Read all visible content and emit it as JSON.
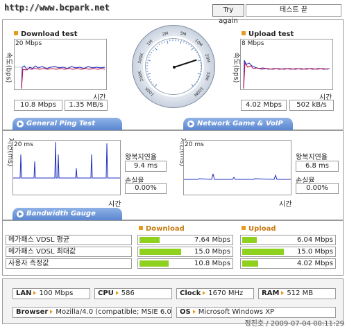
{
  "header": {
    "url_logo": "http://www.bcpark.net",
    "try_again": "Try again",
    "status": "테스트 끝"
  },
  "download": {
    "title": "Download test",
    "axis_y": "속도(bps)",
    "scale": "20 Mbps",
    "time_label": "시간",
    "mbps": "10.8 Mbps",
    "mbs": "1.35 MB/s"
  },
  "upload": {
    "title": "Upload test",
    "axis_y": "속도(bps)",
    "scale": "8 Mbps",
    "time_label": "시간",
    "mbps": "4.02 Mbps",
    "kbs": "502 kB/s"
  },
  "gauge": {
    "ticks": [
      "100K",
      "200K",
      "500K",
      "1M",
      "2M",
      "5M",
      "10M",
      "20M",
      "50M",
      "100M"
    ],
    "needle_tick_index": 6.9
  },
  "sections": {
    "ping": "General Ping Test",
    "game": "Network Game & VoIP Test",
    "bandwidth": "Bandwidth Gauge"
  },
  "ping": {
    "axis_y": "지연(ms)",
    "scale": "20 ms",
    "time_label": "시간",
    "latency_label": "왕복지연율",
    "latency": "9.4 ms",
    "loss_label": "손실율",
    "loss": "0.00%"
  },
  "game": {
    "axis_y": "지연(ms)",
    "scale": "20 ms",
    "time_label": "시간",
    "latency_label": "왕복지연율",
    "latency": "6.8 ms",
    "loss_label": "손실율",
    "loss": "0.00%"
  },
  "bandwidth": {
    "download_hdr": "Download",
    "upload_hdr": "Upload",
    "rows": [
      {
        "label": "메가패스 VDSL 평균",
        "down": "7.64 Mbps",
        "down_frac": 0.42,
        "up": "6.04 Mbps",
        "up_frac": 0.3
      },
      {
        "label": "메가패스 VDSL 최대값",
        "down": "15.0 Mbps",
        "down_frac": 0.85,
        "up": "15.0 Mbps",
        "up_frac": 0.85
      },
      {
        "label": "사용자 측정값",
        "down": "10.8 Mbps",
        "down_frac": 0.6,
        "up": "4.02 Mbps",
        "up_frac": 0.33
      }
    ]
  },
  "info": {
    "lan_label": "LAN",
    "lan": "100 Mbps",
    "cpu_label": "CPU",
    "cpu": "586",
    "clock_label": "Clock",
    "clock": "1670 MHz",
    "ram_label": "RAM",
    "ram": "512 MB",
    "browser_label": "Browser",
    "browser": "Mozilla/4.0 (compatible; MSIE 6.0",
    "os_label": "OS",
    "os": "Microsoft Windows XP"
  },
  "footer": "정진호 / 2009-07-04 00:11:29",
  "colors": {
    "accent": "#e89b22",
    "section_blue": "#5a86d1",
    "bar_green": "#8ed11e",
    "download_line": "#c00040",
    "upload_line": "#2030c0"
  }
}
